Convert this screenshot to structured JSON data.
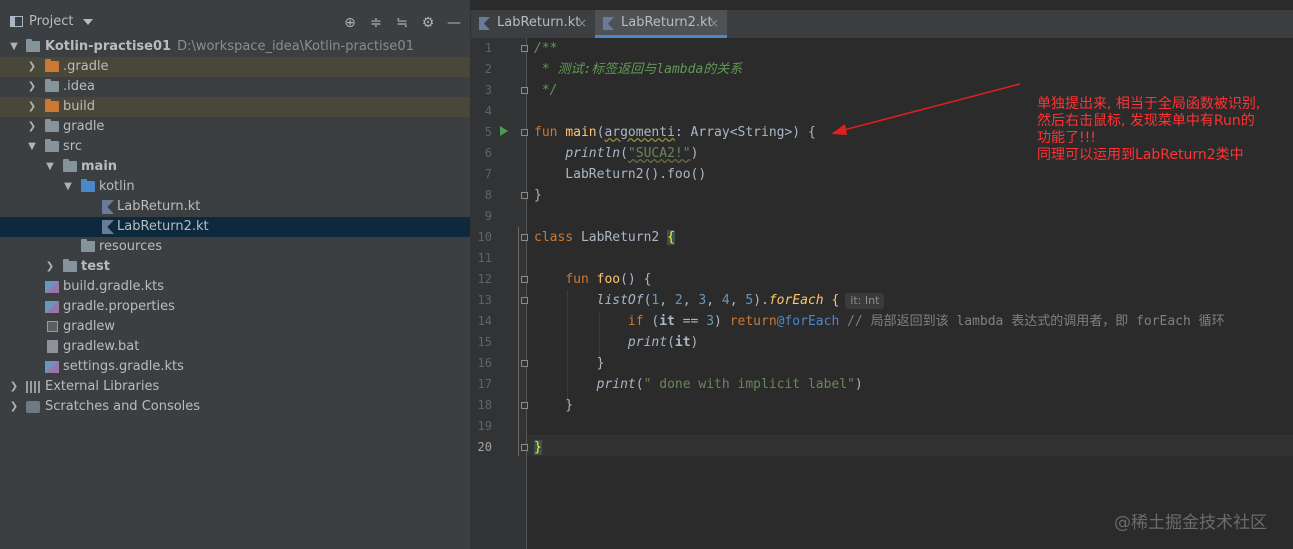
{
  "project_panel": {
    "title": "Project",
    "header_icons": [
      "crosshair-icon",
      "expand-all-icon",
      "collapse-all-icon",
      "gear-icon",
      "minimize-icon"
    ],
    "tree": [
      {
        "label": "Kotlin-practise01",
        "path": "D:\\workspace_idea\\Kotlin-practise01",
        "icon": "module-folder-icon",
        "expanded": true
      },
      {
        "label": ".gradle",
        "icon": "folder-orange-icon",
        "expanded": false
      },
      {
        "label": ".idea",
        "icon": "folder-icon",
        "expanded": false
      },
      {
        "label": "build",
        "icon": "folder-orange-icon",
        "expanded": false
      },
      {
        "label": "gradle",
        "icon": "folder-icon",
        "expanded": false
      },
      {
        "label": "src",
        "icon": "folder-icon",
        "expanded": true
      },
      {
        "label": "main",
        "icon": "source-folder-icon",
        "expanded": true
      },
      {
        "label": "kotlin",
        "icon": "folder-blue-icon",
        "expanded": true
      },
      {
        "label": "LabReturn.kt",
        "icon": "kotlin-file-icon"
      },
      {
        "label": "LabReturn2.kt",
        "icon": "kotlin-file-icon",
        "selected": true
      },
      {
        "label": "resources",
        "icon": "resources-folder-icon"
      },
      {
        "label": "test",
        "icon": "source-folder-icon",
        "expanded": false
      },
      {
        "label": "build.gradle.kts",
        "icon": "gradle-kts-icon"
      },
      {
        "label": "gradle.properties",
        "icon": "gradle-kts-icon"
      },
      {
        "label": "gradlew",
        "icon": "terminal-file-icon"
      },
      {
        "label": "gradlew.bat",
        "icon": "text-file-icon"
      },
      {
        "label": "settings.gradle.kts",
        "icon": "gradle-kts-icon"
      },
      {
        "label": "External Libraries",
        "icon": "libraries-icon",
        "expanded": false
      },
      {
        "label": "Scratches and Consoles",
        "icon": "scratches-icon",
        "expanded": false
      }
    ]
  },
  "tabs": [
    {
      "label": "LabReturn.kt",
      "active": false
    },
    {
      "label": "LabReturn2.kt",
      "active": true
    }
  ],
  "tab_close_glyph": "×",
  "editor": {
    "line_numbers": [
      "1",
      "2",
      "3",
      "4",
      "5",
      "6",
      "7",
      "8",
      "9",
      "10",
      "11",
      "12",
      "13",
      "14",
      "15",
      "16",
      "17",
      "18",
      "19",
      "20"
    ],
    "current_line": "20",
    "code": {
      "l1": "/**",
      "l2": " * 测试:标签返回与lambda的关系",
      "l3": " */",
      "l5_kw": "fun ",
      "l5_fn": "main",
      "l5_p1": "(",
      "l5_param": "argomenti",
      "l5_p2": ": Array<String>) {",
      "l6_indent": "    ",
      "l6_fn": "println",
      "l6_p1": "(",
      "l6_str": "\"SUCA2!\"",
      "l6_p2": ")",
      "l7": "    LabReturn2().foo()",
      "l8": "}",
      "l10_kw": "class ",
      "l10_name": "LabReturn2 ",
      "l10_brace": "{",
      "l12_indent": "    ",
      "l12_kw": "fun ",
      "l12_fn": "foo",
      "l12_rest": "() {",
      "l13_indent": "        ",
      "l13_fn": "listOf",
      "l13_p1": "(",
      "l13_n1": "1",
      "l13_c1": ", ",
      "l13_n2": "2",
      "l13_c2": ", ",
      "l13_n3": "3",
      "l13_c3": ", ",
      "l13_n4": "4",
      "l13_c4": ", ",
      "l13_n5": "5",
      "l13_p2": ").",
      "l13_fe": "forEach",
      "l13_p3": " {",
      "l13_hint": "it: Int",
      "l14_indent": "            ",
      "l14_kw1": "if ",
      "l14_p1": "(",
      "l14_it": "it",
      "l14_op": " == ",
      "l14_n": "3",
      "l14_p2": ") ",
      "l14_kw2": "return",
      "l14_lbl": "@forEach",
      "l14_cmt": " // 局部返回到该 lambda 表达式的调用者，即 forEach 循环",
      "l15_indent": "            ",
      "l15_fn": "print",
      "l15_p1": "(",
      "l15_it": "it",
      "l15_p2": ")",
      "l16": "        }",
      "l17_indent": "        ",
      "l17_fn": "print",
      "l17_p1": "(",
      "l17_str": "\" done with implicit label\"",
      "l17_p2": ")",
      "l18": "    }",
      "l20": "}"
    }
  },
  "annotation": {
    "lines": [
      "单独提出来, 相当于全局函数被识别,",
      "然后右击鼠标, 发现菜单中有Run的",
      "功能了!!!",
      "同理可以运用到LabReturn2类中"
    ],
    "color": "#ff3333"
  },
  "watermark": "@稀土掘金技术社区"
}
